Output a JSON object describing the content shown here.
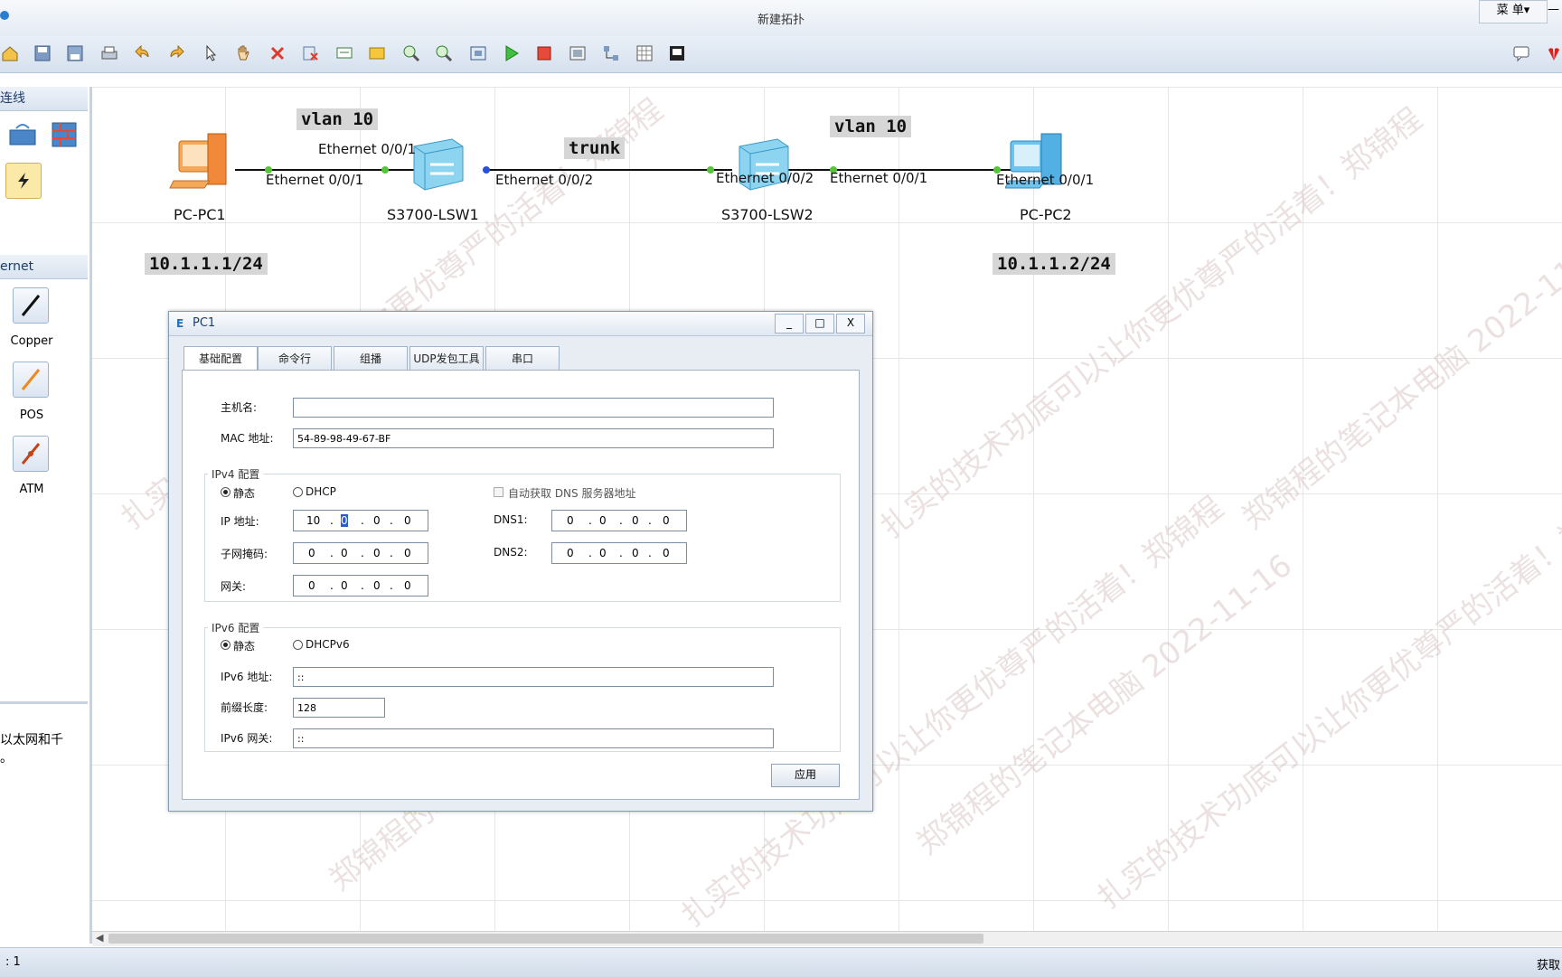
{
  "window": {
    "title": "新建拓扑",
    "menu_label": "菜 单▾",
    "min_label": "—"
  },
  "toolbar": {
    "icons": [
      "home-icon",
      "save-icon",
      "save-as-icon",
      "print-icon",
      "undo-icon",
      "redo-icon",
      "pointer-icon",
      "hand-icon",
      "delete-icon",
      "delete-link-icon",
      "text-icon",
      "rectangle-icon",
      "zoom-in-icon",
      "zoom-out-icon",
      "fit-icon",
      "start-icon",
      "stop-icon",
      "capture-icon",
      "topology-icon",
      "grid-icon",
      "screen-icon"
    ]
  },
  "left_panel": {
    "section1_title": "连线",
    "section2_title": "ernet",
    "cables": [
      {
        "label": "Copper",
        "color": "#111111"
      },
      {
        "label": "POS",
        "color": "#f08a1c"
      },
      {
        "label": "ATM",
        "color": "#c0461a"
      }
    ],
    "description": "以太网和千\n。"
  },
  "topology": {
    "tags": {
      "vlan_left": "vlan 10",
      "vlan_right": "vlan 10",
      "trunk": "trunk",
      "ip_pc1": "10.1.1.1/24",
      "ip_pc2": "10.1.1.2/24"
    },
    "devices": {
      "pc1": "PC-PC1",
      "lsw1": "S3700-LSW1",
      "lsw2": "S3700-LSW2",
      "pc2": "PC-PC2"
    },
    "ports": {
      "pc1_e001": "Ethernet 0/0/1",
      "lsw1_e001": "Ethernet 0/0/1",
      "lsw1_e002": "Ethernet 0/0/2",
      "lsw2_e002": "Ethernet 0/0/2",
      "lsw2_e001": "Ethernet 0/0/1",
      "pc2_e001": "Ethernet 0/0/1"
    },
    "watermark": [
      "扎实的技术功底可以让你更优尊严的活着！郑锦程",
      "郑锦程的笔记本电脑 2022-11-16"
    ]
  },
  "dialog": {
    "title": "PC1",
    "tabs": [
      "基础配置",
      "命令行",
      "组播",
      "UDP发包工具",
      "串口"
    ],
    "hostname_label": "主机名:",
    "hostname_value": "",
    "mac_label": "MAC 地址:",
    "mac_value": "54-89-98-49-67-BF",
    "ipv4_title": "IPv4 配置",
    "static_label": "静态",
    "dhcp_label": "DHCP",
    "auto_dns_label": "自动获取 DNS 服务器地址",
    "ip_label": "IP 地址:",
    "ip_value": [
      "10",
      "0",
      "0",
      "0"
    ],
    "mask_label": "子网掩码:",
    "mask_value": [
      "0",
      "0",
      "0",
      "0"
    ],
    "gw_label": "网关:",
    "gw_value": [
      "0",
      "0",
      "0",
      "0"
    ],
    "dns1_label": "DNS1:",
    "dns1_value": [
      "0",
      "0",
      "0",
      "0"
    ],
    "dns2_label": "DNS2:",
    "dns2_value": [
      "0",
      "0",
      "0",
      "0"
    ],
    "ipv6_title": "IPv6 配置",
    "static6_label": "静态",
    "dhcp6_label": "DHCPv6",
    "ipv6_label": "IPv6 地址:",
    "ipv6_value": "::",
    "prefix_label": "前缀长度:",
    "prefix_value": "128",
    "ipv6gw_label": "IPv6 网关:",
    "ipv6gw_value": "::",
    "apply_label": "应用"
  },
  "statusbar": {
    "left": ": 1",
    "right": "获取"
  }
}
